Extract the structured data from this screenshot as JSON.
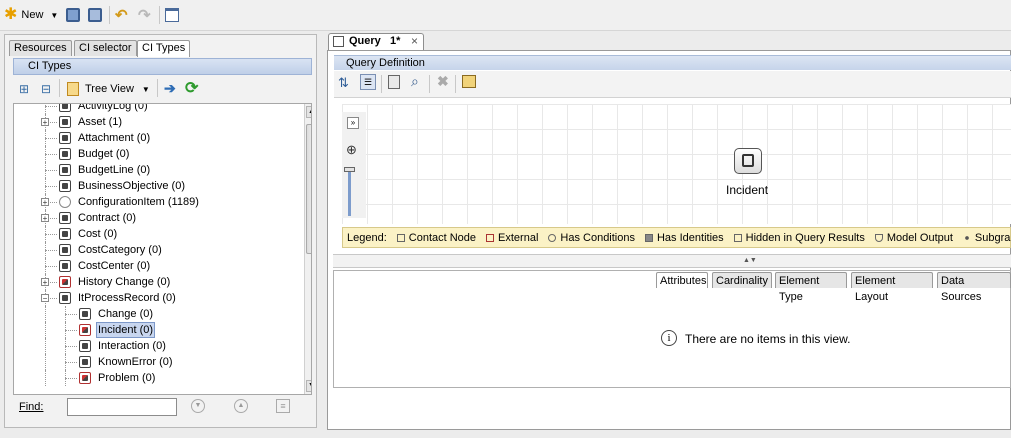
{
  "toolbar": {
    "new_label": "New",
    "buttons": [
      "new-icon",
      "save-icon",
      "save-all-icon",
      "undo-icon",
      "redo-icon",
      "window-icon"
    ]
  },
  "left_panel": {
    "tabs": [
      "Resources",
      "CI selector",
      "CI Types"
    ],
    "active_tab": "CI Types",
    "header": "CI Types",
    "view_label": "Tree View",
    "tree": [
      {
        "label": "ActivityLog (0)",
        "level": 1,
        "icon": "node",
        "expander": ""
      },
      {
        "label": "Asset (1)",
        "level": 1,
        "icon": "node",
        "expander": "+"
      },
      {
        "label": "Attachment (0)",
        "level": 1,
        "icon": "node",
        "expander": ""
      },
      {
        "label": "Budget (0)",
        "level": 1,
        "icon": "node",
        "expander": ""
      },
      {
        "label": "BudgetLine (0)",
        "level": 1,
        "icon": "node",
        "expander": ""
      },
      {
        "label": "BusinessObjective (0)",
        "level": 1,
        "icon": "node",
        "expander": ""
      },
      {
        "label": "ConfigurationItem (1189)",
        "level": 1,
        "icon": "ring",
        "expander": "+"
      },
      {
        "label": "Contract (0)",
        "level": 1,
        "icon": "node",
        "expander": "+"
      },
      {
        "label": "Cost (0)",
        "level": 1,
        "icon": "node",
        "expander": ""
      },
      {
        "label": "CostCategory (0)",
        "level": 1,
        "icon": "node",
        "expander": ""
      },
      {
        "label": "CostCenter (0)",
        "level": 1,
        "icon": "node",
        "expander": ""
      },
      {
        "label": "History Change (0)",
        "level": 1,
        "icon": "red",
        "expander": "+"
      },
      {
        "label": "ItProcessRecord (0)",
        "level": 1,
        "icon": "node",
        "expander": "-"
      },
      {
        "label": "Change (0)",
        "level": 2,
        "icon": "node",
        "expander": ""
      },
      {
        "label": "Incident (0)",
        "level": 2,
        "icon": "red",
        "expander": "",
        "selected": true
      },
      {
        "label": "Interaction (0)",
        "level": 2,
        "icon": "node",
        "expander": ""
      },
      {
        "label": "KnownError (0)",
        "level": 2,
        "icon": "node",
        "expander": ""
      },
      {
        "label": "Problem (0)",
        "level": 2,
        "icon": "red",
        "expander": ""
      }
    ],
    "find_label": "Find:",
    "find_value": ""
  },
  "query": {
    "tab_title": "Query   1*",
    "definition_header": "Query Definition",
    "node_label": "Incident",
    "legend_title": "Legend:",
    "legend_items": [
      "Contact Node",
      "External",
      "Has Conditions",
      "Has Identities",
      "Hidden in Query Results",
      "Model Output",
      "Subgraph"
    ],
    "bottom_tabs": [
      "Attributes",
      "Cardinality",
      "Element Type",
      "Element Layout",
      "Data Sources"
    ],
    "active_bottom_tab": "Attributes",
    "empty_message": "There are no items in this view."
  },
  "colors": {
    "header_blue": "#c6d4ea",
    "legend_yellow": "#fbf2c6",
    "selection": "#c8d6ef"
  }
}
